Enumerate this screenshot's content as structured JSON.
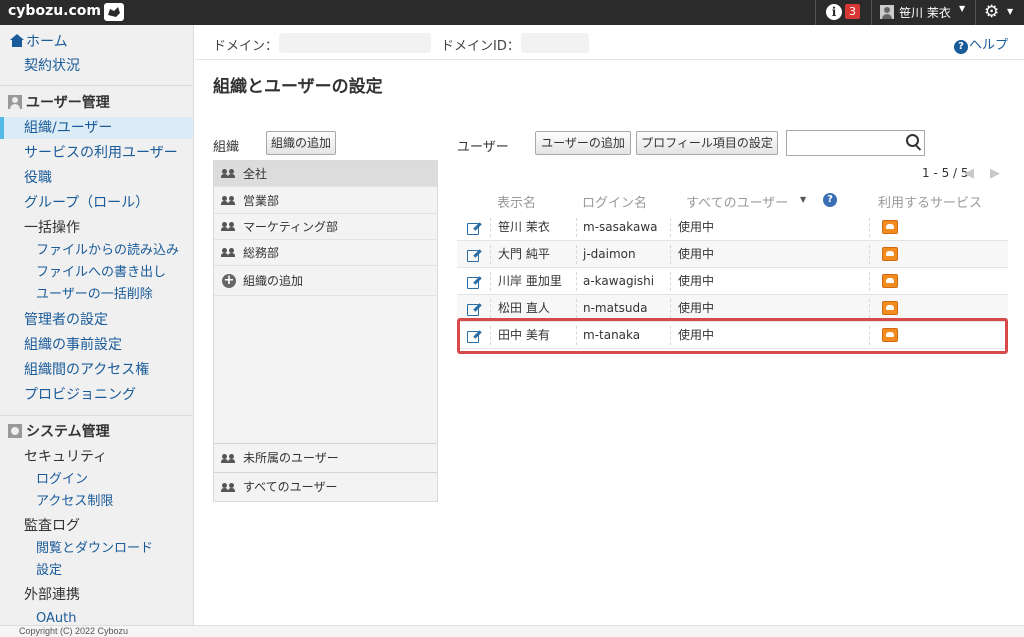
{
  "topbar": {
    "brand": "cybozu.com",
    "notification_count": "3",
    "user_name": "笹川 茉衣"
  },
  "sidebar": {
    "home": "ホーム",
    "contract": "契約状況",
    "user_mgmt_heading": "ユーザー管理",
    "user_items": [
      "組織/ユーザー",
      "サービスの利用ユーザー",
      "役職",
      "グループ（ロール）",
      "一括操作"
    ],
    "bulk_items": [
      "ファイルからの読み込み",
      "ファイルへの書き出し",
      "ユーザーの一括削除"
    ],
    "user_items2": [
      "管理者の設定",
      "組織の事前設定",
      "組織間のアクセス権",
      "プロビジョニング"
    ],
    "system_heading": "システム管理",
    "security": "セキュリティ",
    "security_items": [
      "ログイン",
      "アクセス制限"
    ],
    "audit": "監査ログ",
    "audit_items": [
      "閲覧とダウンロード",
      "設定"
    ],
    "external": "外部連携",
    "external_items": [
      "OAuth"
    ]
  },
  "footer": "Copyright (C) 2022 Cybozu",
  "domainbar": {
    "domain_label": "ドメイン：",
    "domain_id_label": "ドメインID：",
    "help": "ヘルプ"
  },
  "page_title": "組織とユーザーの設定",
  "org": {
    "label": "組織",
    "add_button": "組織の追加",
    "items": [
      "全社",
      "営業部",
      "マーケティング部",
      "総務部"
    ],
    "add_item": "組織の追加",
    "unassigned": "未所属のユーザー",
    "all_users": "すべてのユーザー"
  },
  "users": {
    "label": "ユーザー",
    "add_button": "ユーザーの追加",
    "profile_button": "プロフィール項目の設定",
    "search_placeholder": "",
    "pager": "1 - 5 / 5",
    "columns": {
      "display_name": "表示名",
      "login_name": "ログイン名",
      "filter": "すべてのユーザー",
      "services": "利用するサービス"
    },
    "rows": [
      {
        "name": "笹川 茉衣",
        "login": "m-sasakawa",
        "status": "使用中"
      },
      {
        "name": "大門 純平",
        "login": "j-daimon",
        "status": "使用中"
      },
      {
        "name": "川岸 亜加里",
        "login": "a-kawagishi",
        "status": "使用中"
      },
      {
        "name": "松田 直人",
        "login": "n-matsuda",
        "status": "使用中"
      },
      {
        "name": "田中 美有",
        "login": "m-tanaka",
        "status": "使用中"
      }
    ]
  },
  "colors": {
    "topbar": "#2b2b2b",
    "link": "#1a5b99",
    "highlight": "#d84a4a",
    "badge": "#d93636",
    "service_icon": "#f28c1e"
  }
}
